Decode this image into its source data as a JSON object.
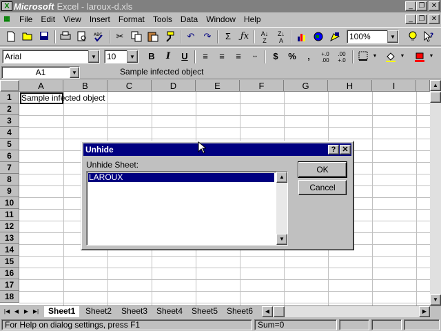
{
  "titlebar": {
    "brand": "Microsoft",
    "title": "Excel - laroux-d.xls",
    "controls": [
      "_",
      "❐",
      "✕"
    ]
  },
  "menubar": {
    "items": [
      "File",
      "Edit",
      "View",
      "Insert",
      "Format",
      "Tools",
      "Data",
      "Window",
      "Help"
    ],
    "controls": [
      "_",
      "❐",
      "✕"
    ]
  },
  "toolbar_standard": {
    "zoom": "100%"
  },
  "toolbar_format": {
    "font": "Arial",
    "size": "10"
  },
  "formula_bar": {
    "cell_ref": "A1",
    "content": "Sample infected object"
  },
  "grid": {
    "columns": [
      "A",
      "B",
      "C",
      "D",
      "E",
      "F",
      "G",
      "H",
      "I"
    ],
    "rows": [
      "1",
      "2",
      "3",
      "4",
      "5",
      "6",
      "7",
      "8",
      "9",
      "10",
      "11",
      "12",
      "13",
      "14",
      "15",
      "16",
      "17",
      "18"
    ],
    "a1_value": "Sample infected object"
  },
  "sheet_tabs": [
    "Sheet1",
    "Sheet2",
    "Sheet3",
    "Sheet4",
    "Sheet5",
    "Sheet6"
  ],
  "status": {
    "help_text": "For Help on dialog settings, press F1",
    "sum": "Sum=0"
  },
  "dialog": {
    "title": "Unhide",
    "label": "Unhide Sheet:",
    "list_items": [
      "LAROUX"
    ],
    "ok_label": "OK",
    "cancel_label": "Cancel",
    "help_btn": "?",
    "close_btn": "✕"
  },
  "colors": {
    "titlebar_active": "#000080",
    "face": "#c0c0c0",
    "grid_line": "#c0c0c0"
  }
}
